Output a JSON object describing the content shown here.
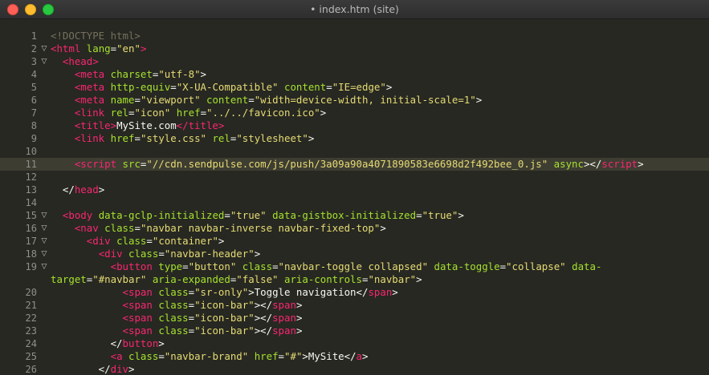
{
  "window": {
    "title": "• index.htm (site)"
  },
  "theme": {
    "background": "#272822",
    "tag": "#f92672",
    "attribute": "#a6e22e",
    "string": "#e6db74",
    "text": "#f8f8f2",
    "comment": "#75715e"
  },
  "icons": {
    "fold": "disclosure-triangle-down-icon"
  },
  "lines": [
    {
      "num": "1",
      "fold": "",
      "hl": false,
      "tokens": [
        [
          "comment",
          "<!DOCTYPE html>"
        ]
      ]
    },
    {
      "num": "2",
      "fold": "▽",
      "hl": false,
      "tokens": [
        [
          "t",
          "<html"
        ],
        [
          "p",
          " "
        ],
        [
          "a",
          "lang"
        ],
        [
          "p",
          "="
        ],
        [
          "s",
          "\"en\""
        ],
        [
          "t",
          ">"
        ]
      ]
    },
    {
      "num": "3",
      "fold": "▽",
      "hl": false,
      "tokens": [
        [
          "p",
          "  "
        ],
        [
          "t",
          "<head>"
        ]
      ]
    },
    {
      "num": "4",
      "fold": "",
      "hl": false,
      "tokens": [
        [
          "p",
          "    "
        ],
        [
          "t",
          "<meta"
        ],
        [
          "p",
          " "
        ],
        [
          "a",
          "charset"
        ],
        [
          "p",
          "="
        ],
        [
          "s",
          "\"utf-8\""
        ],
        [
          "p",
          ">"
        ]
      ]
    },
    {
      "num": "5",
      "fold": "",
      "hl": false,
      "tokens": [
        [
          "p",
          "    "
        ],
        [
          "t",
          "<meta"
        ],
        [
          "p",
          " "
        ],
        [
          "a",
          "http-equiv"
        ],
        [
          "p",
          "="
        ],
        [
          "s",
          "\"X-UA-Compatible\""
        ],
        [
          "p",
          " "
        ],
        [
          "a",
          "content"
        ],
        [
          "p",
          "="
        ],
        [
          "s",
          "\"IE=edge\""
        ],
        [
          "p",
          ">"
        ]
      ]
    },
    {
      "num": "6",
      "fold": "",
      "hl": false,
      "tokens": [
        [
          "p",
          "    "
        ],
        [
          "t",
          "<meta"
        ],
        [
          "p",
          " "
        ],
        [
          "a",
          "name"
        ],
        [
          "p",
          "="
        ],
        [
          "s",
          "\"viewport\""
        ],
        [
          "p",
          " "
        ],
        [
          "a",
          "content"
        ],
        [
          "p",
          "="
        ],
        [
          "s",
          "\"width=device-width, initial-scale=1\""
        ],
        [
          "p",
          ">"
        ]
      ]
    },
    {
      "num": "7",
      "fold": "",
      "hl": false,
      "tokens": [
        [
          "p",
          "    "
        ],
        [
          "t",
          "<link"
        ],
        [
          "p",
          " "
        ],
        [
          "a",
          "rel"
        ],
        [
          "p",
          "="
        ],
        [
          "s",
          "\"icon\""
        ],
        [
          "p",
          " "
        ],
        [
          "a",
          "href"
        ],
        [
          "p",
          "="
        ],
        [
          "s",
          "\"../../favicon.ico\""
        ],
        [
          "p",
          ">"
        ]
      ]
    },
    {
      "num": "8",
      "fold": "",
      "hl": false,
      "tokens": [
        [
          "p",
          "    "
        ],
        [
          "t",
          "<title>"
        ],
        [
          "p",
          "MySite.com"
        ],
        [
          "t",
          "</title>"
        ]
      ]
    },
    {
      "num": "9",
      "fold": "",
      "hl": false,
      "tokens": [
        [
          "p",
          "    "
        ],
        [
          "t",
          "<link"
        ],
        [
          "p",
          " "
        ],
        [
          "a",
          "href"
        ],
        [
          "p",
          "="
        ],
        [
          "s",
          "\"style.css\""
        ],
        [
          "p",
          " "
        ],
        [
          "a",
          "rel"
        ],
        [
          "p",
          "="
        ],
        [
          "s",
          "\"stylesheet\""
        ],
        [
          "p",
          ">"
        ]
      ]
    },
    {
      "num": "10",
      "fold": "",
      "hl": false,
      "tokens": []
    },
    {
      "num": "11",
      "fold": "",
      "hl": true,
      "tokens": [
        [
          "p",
          "    "
        ],
        [
          "t",
          "<script"
        ],
        [
          "p",
          " "
        ],
        [
          "a",
          "src"
        ],
        [
          "p",
          "="
        ],
        [
          "s",
          "\"//cdn.sendpulse.com/js/push/3a09a90a4071890583e6698d2f492bee_0.js\""
        ],
        [
          "p",
          " "
        ],
        [
          "a",
          "async"
        ],
        [
          "p",
          "></"
        ],
        [
          "t",
          "script"
        ],
        [
          "p",
          ">"
        ]
      ]
    },
    {
      "num": "12",
      "fold": "",
      "hl": false,
      "tokens": []
    },
    {
      "num": "13",
      "fold": "",
      "hl": false,
      "tokens": [
        [
          "p",
          "  </"
        ],
        [
          "t",
          "head"
        ],
        [
          "p",
          ">"
        ]
      ]
    },
    {
      "num": "14",
      "fold": "",
      "hl": false,
      "tokens": []
    },
    {
      "num": "15",
      "fold": "▽",
      "hl": false,
      "tokens": [
        [
          "p",
          "  "
        ],
        [
          "t",
          "<body"
        ],
        [
          "p",
          " "
        ],
        [
          "a",
          "data-gclp-initialized"
        ],
        [
          "p",
          "="
        ],
        [
          "s",
          "\"true\""
        ],
        [
          "p",
          " "
        ],
        [
          "a",
          "data-gistbox-initialized"
        ],
        [
          "p",
          "="
        ],
        [
          "s",
          "\"true\""
        ],
        [
          "p",
          ">"
        ]
      ]
    },
    {
      "num": "16",
      "fold": "▽",
      "hl": false,
      "tokens": [
        [
          "p",
          "    "
        ],
        [
          "t",
          "<nav"
        ],
        [
          "p",
          " "
        ],
        [
          "a",
          "class"
        ],
        [
          "p",
          "="
        ],
        [
          "s",
          "\"navbar navbar-inverse navbar-fixed-top\""
        ],
        [
          "p",
          ">"
        ]
      ]
    },
    {
      "num": "17",
      "fold": "▽",
      "hl": false,
      "tokens": [
        [
          "p",
          "      "
        ],
        [
          "t",
          "<div"
        ],
        [
          "p",
          " "
        ],
        [
          "a",
          "class"
        ],
        [
          "p",
          "="
        ],
        [
          "s",
          "\"container\""
        ],
        [
          "p",
          ">"
        ]
      ]
    },
    {
      "num": "18",
      "fold": "▽",
      "hl": false,
      "tokens": [
        [
          "p",
          "        "
        ],
        [
          "t",
          "<div"
        ],
        [
          "p",
          " "
        ],
        [
          "a",
          "class"
        ],
        [
          "p",
          "="
        ],
        [
          "s",
          "\"navbar-header\""
        ],
        [
          "p",
          ">"
        ]
      ]
    },
    {
      "num": "19",
      "fold": "▽",
      "hl": false,
      "tokens": [
        [
          "p",
          "          "
        ],
        [
          "t",
          "<button"
        ],
        [
          "p",
          " "
        ],
        [
          "a",
          "type"
        ],
        [
          "p",
          "="
        ],
        [
          "s",
          "\"button\""
        ],
        [
          "p",
          " "
        ],
        [
          "a",
          "class"
        ],
        [
          "p",
          "="
        ],
        [
          "s",
          "\"navbar-toggle collapsed\""
        ],
        [
          "p",
          " "
        ],
        [
          "a",
          "data-toggle"
        ],
        [
          "p",
          "="
        ],
        [
          "s",
          "\"collapse\""
        ],
        [
          "p",
          " "
        ],
        [
          "a",
          "data-"
        ]
      ]
    },
    {
      "num": "",
      "fold": "",
      "hl": false,
      "tokens": [
        [
          "a",
          "target"
        ],
        [
          "p",
          "="
        ],
        [
          "s",
          "\"#navbar\""
        ],
        [
          "p",
          " "
        ],
        [
          "a",
          "aria-expanded"
        ],
        [
          "p",
          "="
        ],
        [
          "s",
          "\"false\""
        ],
        [
          "p",
          " "
        ],
        [
          "a",
          "aria-controls"
        ],
        [
          "p",
          "="
        ],
        [
          "s",
          "\"navbar\""
        ],
        [
          "p",
          ">"
        ]
      ]
    },
    {
      "num": "20",
      "fold": "",
      "hl": false,
      "tokens": [
        [
          "p",
          "            "
        ],
        [
          "t",
          "<span"
        ],
        [
          "p",
          " "
        ],
        [
          "a",
          "class"
        ],
        [
          "p",
          "="
        ],
        [
          "s",
          "\"sr-only\""
        ],
        [
          "p",
          ">Toggle navigation</"
        ],
        [
          "t",
          "span"
        ],
        [
          "p",
          ">"
        ]
      ]
    },
    {
      "num": "21",
      "fold": "",
      "hl": false,
      "tokens": [
        [
          "p",
          "            "
        ],
        [
          "t",
          "<span"
        ],
        [
          "p",
          " "
        ],
        [
          "a",
          "class"
        ],
        [
          "p",
          "="
        ],
        [
          "s",
          "\"icon-bar\""
        ],
        [
          "p",
          "></"
        ],
        [
          "t",
          "span"
        ],
        [
          "p",
          ">"
        ]
      ]
    },
    {
      "num": "22",
      "fold": "",
      "hl": false,
      "tokens": [
        [
          "p",
          "            "
        ],
        [
          "t",
          "<span"
        ],
        [
          "p",
          " "
        ],
        [
          "a",
          "class"
        ],
        [
          "p",
          "="
        ],
        [
          "s",
          "\"icon-bar\""
        ],
        [
          "p",
          "></"
        ],
        [
          "t",
          "span"
        ],
        [
          "p",
          ">"
        ]
      ]
    },
    {
      "num": "23",
      "fold": "",
      "hl": false,
      "tokens": [
        [
          "p",
          "            "
        ],
        [
          "t",
          "<span"
        ],
        [
          "p",
          " "
        ],
        [
          "a",
          "class"
        ],
        [
          "p",
          "="
        ],
        [
          "s",
          "\"icon-bar\""
        ],
        [
          "p",
          "></"
        ],
        [
          "t",
          "span"
        ],
        [
          "p",
          ">"
        ]
      ]
    },
    {
      "num": "24",
      "fold": "",
      "hl": false,
      "tokens": [
        [
          "p",
          "          </"
        ],
        [
          "t",
          "button"
        ],
        [
          "p",
          ">"
        ]
      ]
    },
    {
      "num": "25",
      "fold": "",
      "hl": false,
      "tokens": [
        [
          "p",
          "          "
        ],
        [
          "t",
          "<a"
        ],
        [
          "p",
          " "
        ],
        [
          "a",
          "class"
        ],
        [
          "p",
          "="
        ],
        [
          "s",
          "\"navbar-brand\""
        ],
        [
          "p",
          " "
        ],
        [
          "a",
          "href"
        ],
        [
          "p",
          "="
        ],
        [
          "s",
          "\"#\""
        ],
        [
          "p",
          ">MySite</"
        ],
        [
          "t",
          "a"
        ],
        [
          "p",
          ">"
        ]
      ]
    },
    {
      "num": "26",
      "fold": "",
      "hl": false,
      "tokens": [
        [
          "p",
          "        </"
        ],
        [
          "t",
          "div"
        ],
        [
          "p",
          ">"
        ]
      ]
    }
  ]
}
